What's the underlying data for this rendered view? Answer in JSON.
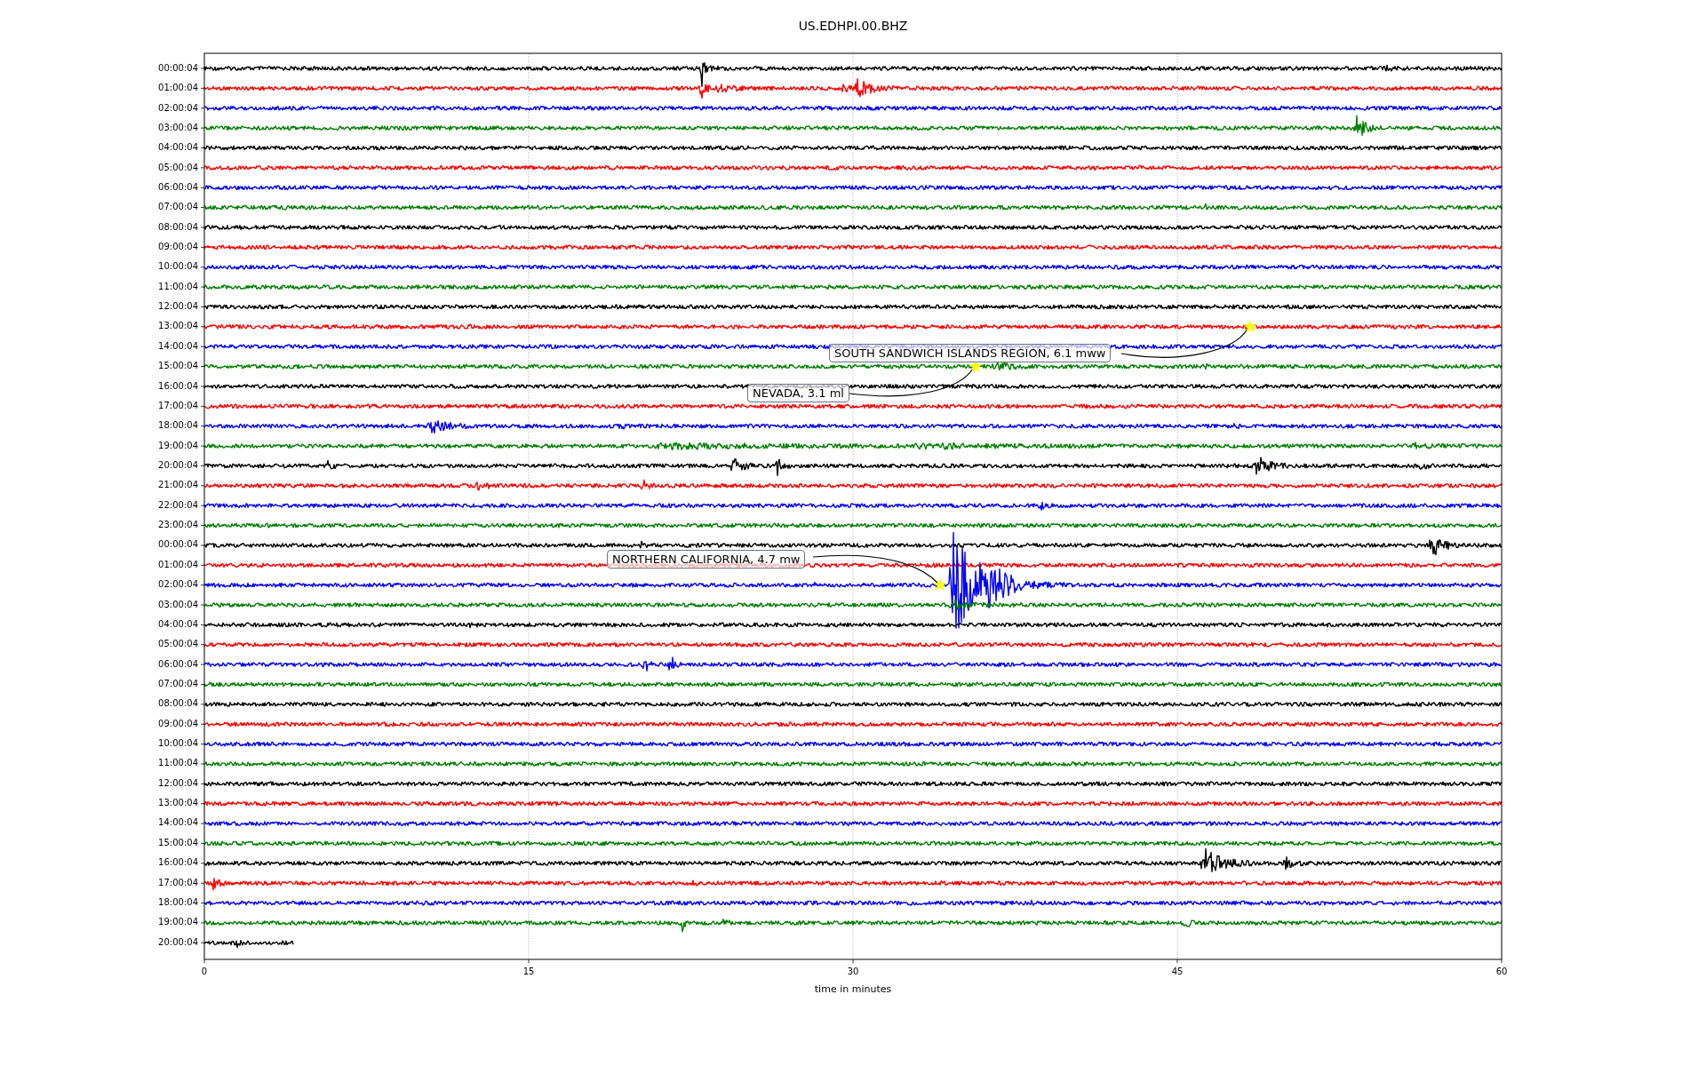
{
  "title": "US.EDHPI.00.BHZ",
  "traces": [
    {
      "label": "00:00:04",
      "color": "#000000",
      "kind": "full"
    },
    {
      "label": "01:00:04",
      "color": "#ff0000",
      "kind": "full"
    },
    {
      "label": "02:00:04",
      "color": "#0000ff",
      "kind": "full"
    },
    {
      "label": "03:00:04",
      "color": "#008000",
      "kind": "full"
    },
    {
      "label": "04:00:04",
      "color": "#000000",
      "kind": "full"
    },
    {
      "label": "05:00:04",
      "color": "#ff0000",
      "kind": "full"
    },
    {
      "label": "06:00:04",
      "color": "#0000ff",
      "kind": "full"
    },
    {
      "label": "07:00:04",
      "color": "#008000",
      "kind": "full"
    },
    {
      "label": "08:00:04",
      "color": "#000000",
      "kind": "full"
    },
    {
      "label": "09:00:04",
      "color": "#ff0000",
      "kind": "full"
    },
    {
      "label": "10:00:04",
      "color": "#0000ff",
      "kind": "full"
    },
    {
      "label": "11:00:04",
      "color": "#008000",
      "kind": "full"
    },
    {
      "label": "12:00:04",
      "color": "#000000",
      "kind": "full"
    },
    {
      "label": "13:00:04",
      "color": "#ff0000",
      "kind": "full"
    },
    {
      "label": "14:00:04",
      "color": "#0000ff",
      "kind": "full"
    },
    {
      "label": "15:00:04",
      "color": "#008000",
      "kind": "full"
    },
    {
      "label": "16:00:04",
      "color": "#000000",
      "kind": "full"
    },
    {
      "label": "17:00:04",
      "color": "#ff0000",
      "kind": "full"
    },
    {
      "label": "18:00:04",
      "color": "#0000ff",
      "kind": "full"
    },
    {
      "label": "19:00:04",
      "color": "#008000",
      "kind": "full"
    },
    {
      "label": "20:00:04",
      "color": "#000000",
      "kind": "full"
    },
    {
      "label": "21:00:04",
      "color": "#ff0000",
      "kind": "full"
    },
    {
      "label": "22:00:04",
      "color": "#0000ff",
      "kind": "full"
    },
    {
      "label": "23:00:04",
      "color": "#008000",
      "kind": "full"
    },
    {
      "label": "00:00:04",
      "color": "#000000",
      "kind": "full"
    },
    {
      "label": "01:00:04",
      "color": "#ff0000",
      "kind": "full"
    },
    {
      "label": "02:00:04",
      "color": "#0000ff",
      "kind": "full"
    },
    {
      "label": "03:00:04",
      "color": "#008000",
      "kind": "full"
    },
    {
      "label": "04:00:04",
      "color": "#000000",
      "kind": "full"
    },
    {
      "label": "05:00:04",
      "color": "#ff0000",
      "kind": "full"
    },
    {
      "label": "06:00:04",
      "color": "#0000ff",
      "kind": "full"
    },
    {
      "label": "07:00:04",
      "color": "#008000",
      "kind": "full"
    },
    {
      "label": "08:00:04",
      "color": "#000000",
      "kind": "full"
    },
    {
      "label": "09:00:04",
      "color": "#ff0000",
      "kind": "full"
    },
    {
      "label": "10:00:04",
      "color": "#0000ff",
      "kind": "full"
    },
    {
      "label": "11:00:04",
      "color": "#008000",
      "kind": "full"
    },
    {
      "label": "12:00:04",
      "color": "#000000",
      "kind": "full"
    },
    {
      "label": "13:00:04",
      "color": "#ff0000",
      "kind": "full"
    },
    {
      "label": "14:00:04",
      "color": "#0000ff",
      "kind": "full"
    },
    {
      "label": "15:00:04",
      "color": "#008000",
      "kind": "full"
    },
    {
      "label": "16:00:04",
      "color": "#000000",
      "kind": "full"
    },
    {
      "label": "17:00:04",
      "color": "#ff0000",
      "kind": "full"
    },
    {
      "label": "18:00:04",
      "color": "#0000ff",
      "kind": "full"
    },
    {
      "label": "19:00:04",
      "color": "#008000",
      "kind": "full"
    },
    {
      "label": "20:00:04",
      "color": "#000000",
      "kind": "partial"
    }
  ],
  "x_ticks": [
    "0",
    "15",
    "30",
    "45",
    "60"
  ],
  "x_label": "time in minutes",
  "annotations": [
    {
      "text": "SOUTH SANDWICH ISLANDS REGION, 6.1 mww"
    },
    {
      "text": "NEVADA, 3.1 ml"
    },
    {
      "text": "NORTHERN CALIFORNIA, 4.7 mw"
    }
  ]
}
